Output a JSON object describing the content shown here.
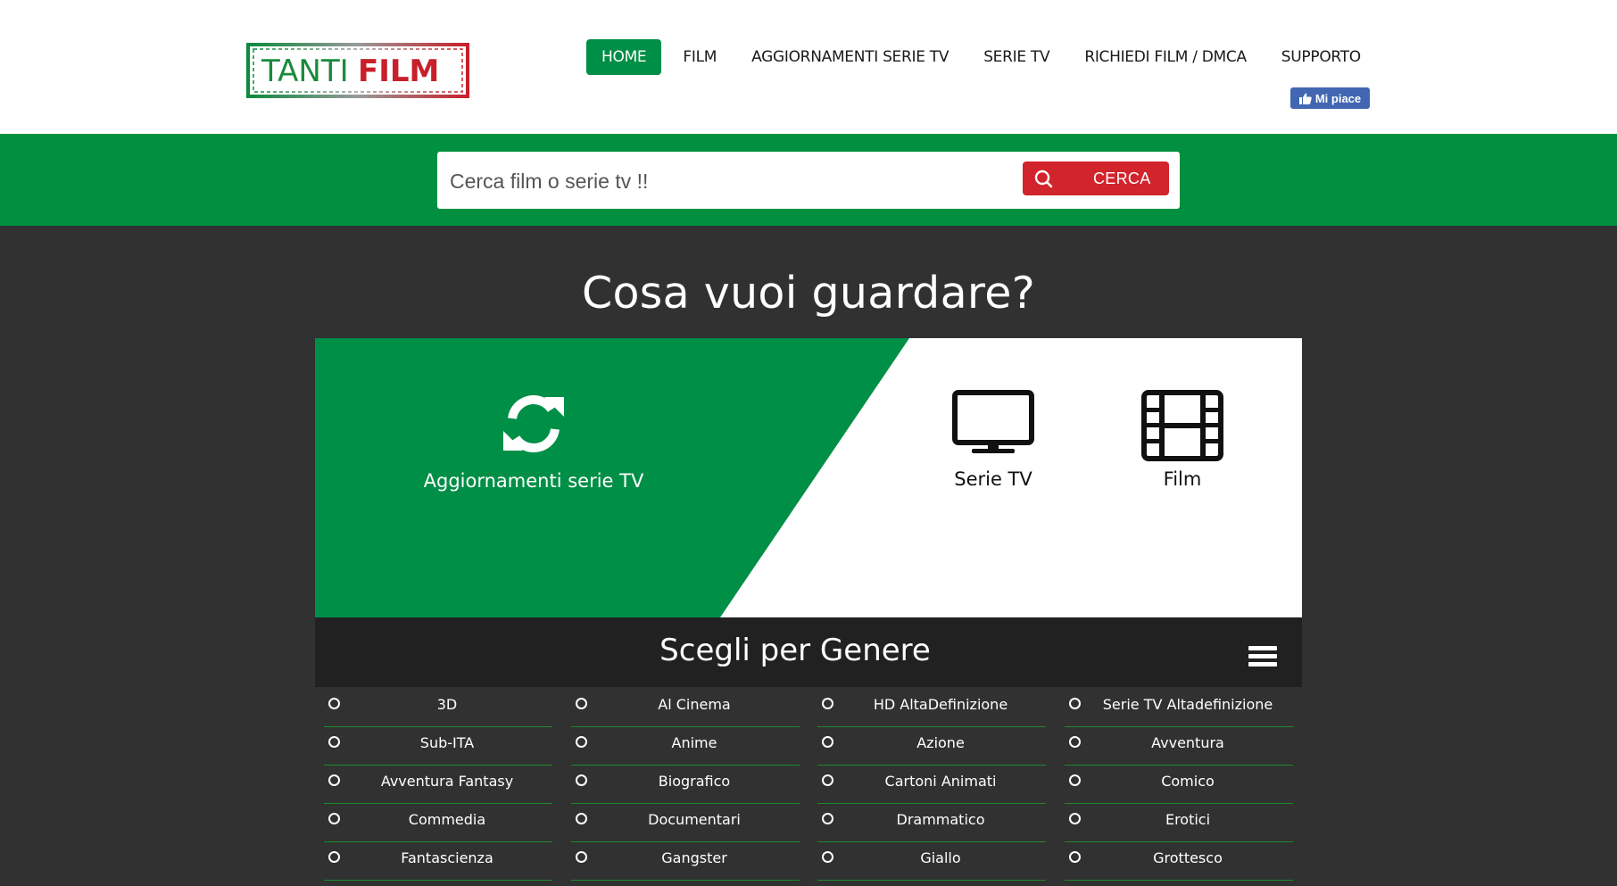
{
  "header": {
    "logo_text": "TANTIFILM",
    "nav": [
      {
        "label": "HOME",
        "active": true
      },
      {
        "label": "FILM",
        "active": false
      },
      {
        "label": "AGGIORNAMENTI SERIE TV",
        "active": false
      },
      {
        "label": "SERIE TV",
        "active": false
      },
      {
        "label": "RICHIEDI FILM / DMCA",
        "active": false
      },
      {
        "label": "SUPPORTO",
        "active": false
      }
    ],
    "fb_like_label": "Mi piace"
  },
  "search": {
    "placeholder": "Cerca film o serie tv !!",
    "button_label": "CERCA"
  },
  "main": {
    "title": "Cosa vuoi guardare?",
    "cards": {
      "updates": {
        "label": "Aggiornamenti serie TV",
        "icon": "sync-icon"
      },
      "series": {
        "label": "Serie TV",
        "icon": "tv-icon"
      },
      "film": {
        "label": "Film",
        "icon": "film-icon"
      }
    }
  },
  "genres": {
    "title": "Scegli per Genere",
    "columns": [
      [
        "3D",
        "Sub-ITA",
        "Avventura Fantasy",
        "Commedia",
        "Fantascienza"
      ],
      [
        "Al Cinema",
        "Anime",
        "Biografico",
        "Documentari",
        "Gangster"
      ],
      [
        "HD AltaDefinizione",
        "Azione",
        "Cartoni Animati",
        "Drammatico",
        "Giallo"
      ],
      [
        "Serie TV Altadefinizione",
        "Avventura",
        "Comico",
        "Erotici",
        "Grottesco"
      ]
    ]
  },
  "colors": {
    "brand_green": "#008f46",
    "search_red": "#d1242c",
    "background_dark": "#313131",
    "genre_bar": "#212121",
    "facebook_blue": "#4267b2"
  }
}
